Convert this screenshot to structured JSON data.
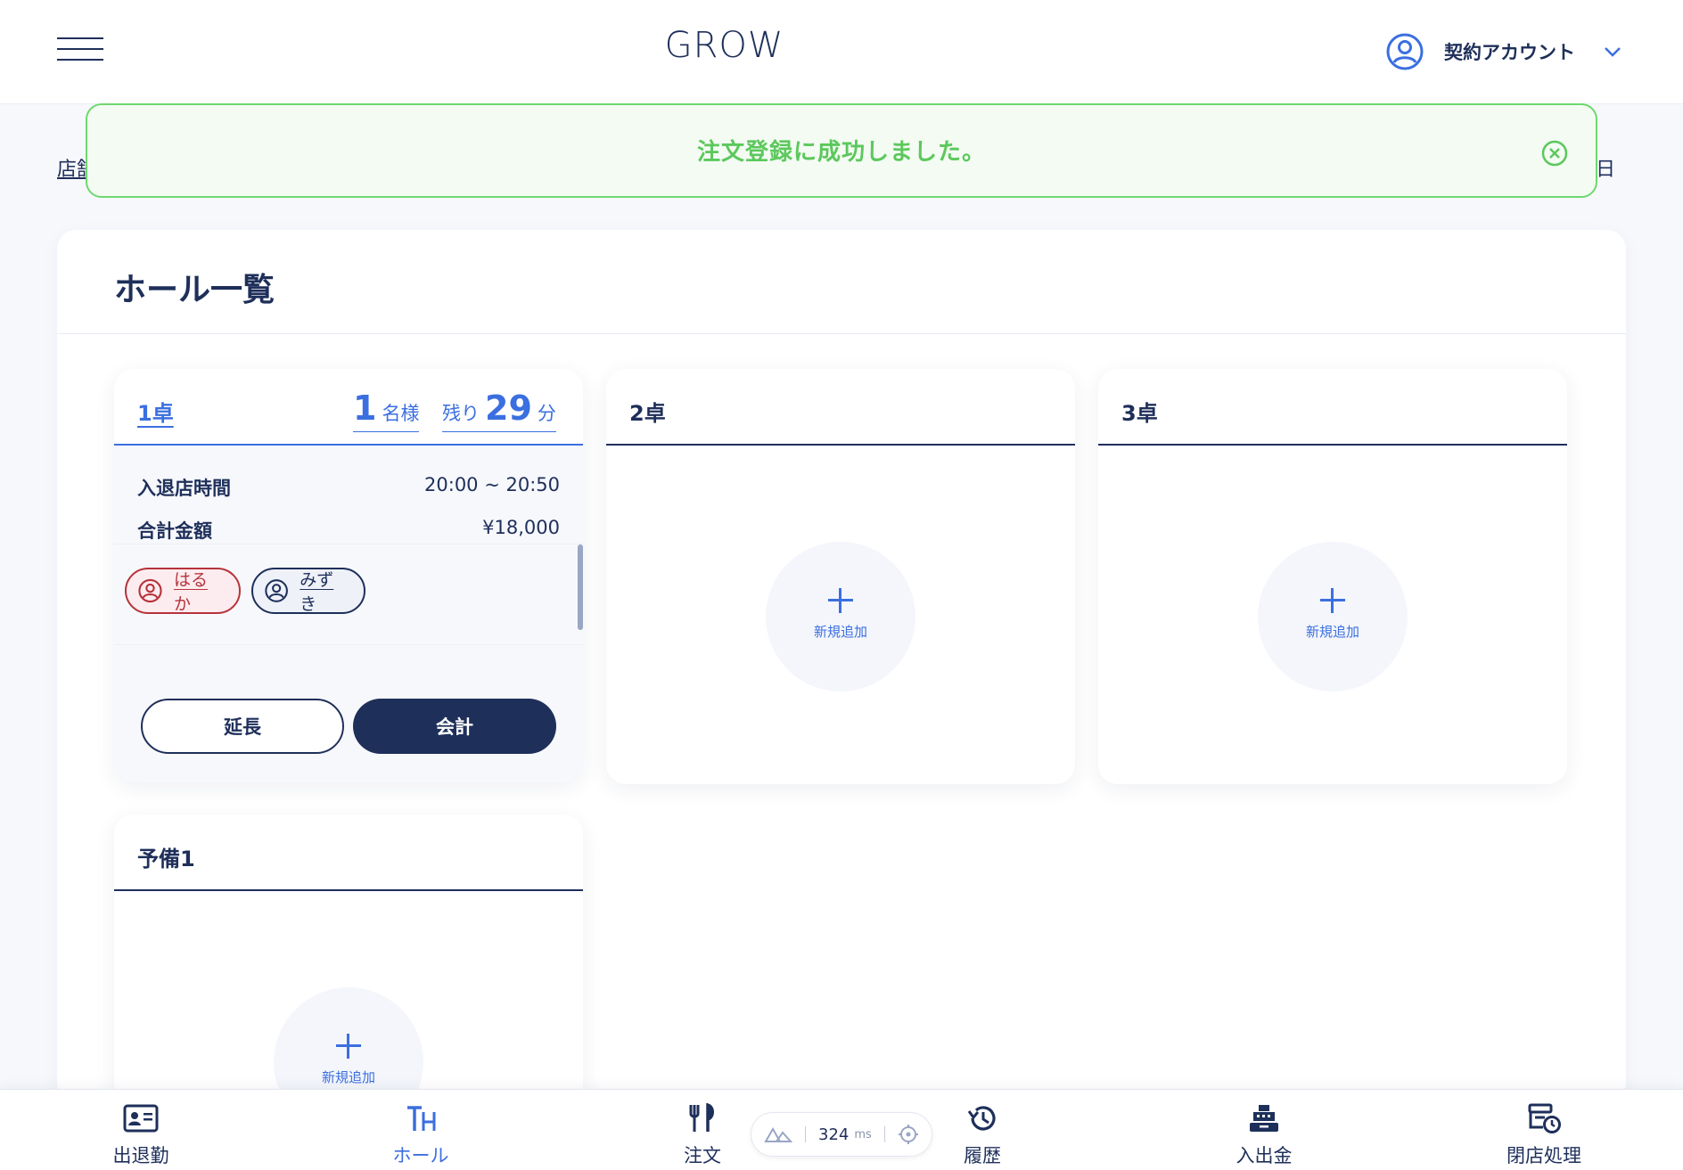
{
  "header": {
    "logo": "GROW",
    "account_label": "契約アカウント"
  },
  "subheader": {
    "store_link": "店舗",
    "date_label": "日"
  },
  "toast": {
    "message": "注文登録に成功しました。"
  },
  "panel": {
    "title": "ホール一覧"
  },
  "tables": [
    {
      "name": "1卓",
      "guests": "1",
      "guests_unit": "名様",
      "remaining_prefix": "残り",
      "remaining": "29",
      "remaining_unit": "分",
      "time_label": "入退店時間",
      "time_value": "20:00 ~ 20:50",
      "total_label": "合計金額",
      "total_value": "¥18,000",
      "staff": [
        {
          "name": "はるか",
          "color": "#b6333b"
        },
        {
          "name": "みずき",
          "color": "#1e2f5a"
        }
      ],
      "extend_label": "延長",
      "checkout_label": "会計"
    },
    {
      "name": "2卓",
      "add_label": "新規追加"
    },
    {
      "name": "3卓",
      "add_label": "新規追加"
    },
    {
      "name": "予備1",
      "add_label": "新規追加"
    }
  ],
  "bottom_nav": {
    "items": [
      {
        "label": "出退勤",
        "icon": "id-card-icon"
      },
      {
        "label": "ホール",
        "icon": "table-icon",
        "active": true
      },
      {
        "label": "注文",
        "icon": "cutlery-icon"
      },
      {
        "label": "履歴",
        "icon": "history-icon"
      },
      {
        "label": "入出金",
        "icon": "cash-register-icon"
      },
      {
        "label": "閉店処理",
        "icon": "store-close-icon"
      }
    ]
  },
  "perf": {
    "value": "324",
    "unit": "ms"
  },
  "colors": {
    "navy": "#1e2f5a",
    "accent_blue": "#3b6fe0",
    "success_green": "#5cc85c",
    "staff_red": "#b6333b"
  }
}
